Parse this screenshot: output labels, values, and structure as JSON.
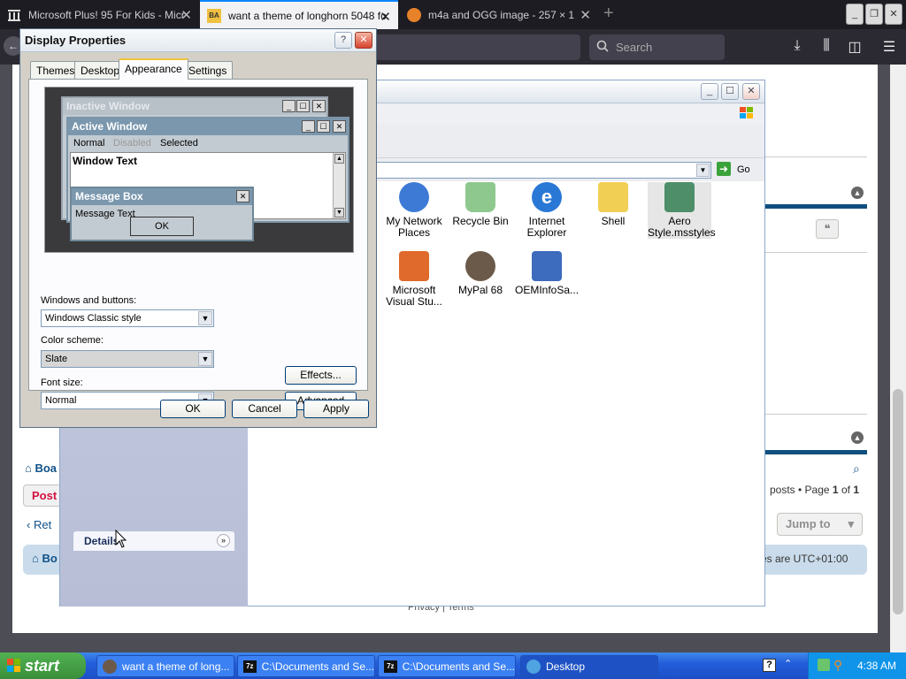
{
  "browser": {
    "tabs": [
      {
        "label": "Microsoft Plus! 95 For Kids - Micr",
        "active": false
      },
      {
        "label": "want a theme of longhorn 5048 fo",
        "active": true
      },
      {
        "label": "m4a and OGG image - 257 × 1",
        "active": false
      }
    ],
    "search_placeholder": "Search"
  },
  "forum": {
    "board_link": "Boa",
    "post_button": "Post",
    "return_link": "Ret",
    "posts_text": "posts • Page",
    "page_current": "1",
    "page_of": "of",
    "page_total": "1",
    "jump_label": "Jump to",
    "footer_board": "Bo",
    "timezone": "es are UTC+01:00",
    "privacy": "Privacy",
    "terms": "Terms"
  },
  "explorer": {
    "go_label": "Go",
    "details_label": "Details",
    "icons": [
      {
        "label": "My Network Places",
        "color": "#3c7ad6"
      },
      {
        "label": "Recycle Bin",
        "color": "#4aa04a"
      },
      {
        "label": "Internet Explorer",
        "color": "#2a78d6"
      },
      {
        "label": "Shell",
        "color": "#f1cf55"
      },
      {
        "label": "Aero Style.msstyles",
        "color": "#4e8f6a"
      },
      {
        "label": "Microsoft Visual Stu...",
        "color": "#e06a2b"
      },
      {
        "label": "MyPal 68",
        "color": "#6b5a4a"
      },
      {
        "label": "OEMInfoSa...",
        "color": "#3d6bbd"
      }
    ]
  },
  "dialog": {
    "title": "Display Properties",
    "tabs": [
      "Themes",
      "Desktop",
      "Appearance",
      "Settings"
    ],
    "preview": {
      "inactive_title": "Inactive Window",
      "active_title": "Active Window",
      "menu_normal": "Normal",
      "menu_disabled": "Disabled",
      "menu_selected": "Selected",
      "window_text": "Window Text",
      "msgbox_title": "Message Box",
      "msgbox_text": "Message Text",
      "msgbox_ok": "OK"
    },
    "windows_buttons_label": "Windows and buttons:",
    "windows_buttons_value": "Windows Classic style",
    "color_scheme_label": "Color scheme:",
    "color_scheme_value": "Slate",
    "font_size_label": "Font size:",
    "font_size_value": "Normal",
    "effects_button": "Effects...",
    "advanced_button": "Advanced",
    "ok_button": "OK",
    "cancel_button": "Cancel",
    "apply_button": "Apply"
  },
  "taskbar": {
    "start_label": "start",
    "tasks": [
      {
        "label": "want a theme of long...",
        "active": false
      },
      {
        "label": "C:\\Documents and Se...",
        "active": false
      },
      {
        "label": "C:\\Documents and Se...",
        "active": false
      },
      {
        "label": "Desktop",
        "active": true
      }
    ],
    "clock": "4:38 AM"
  }
}
